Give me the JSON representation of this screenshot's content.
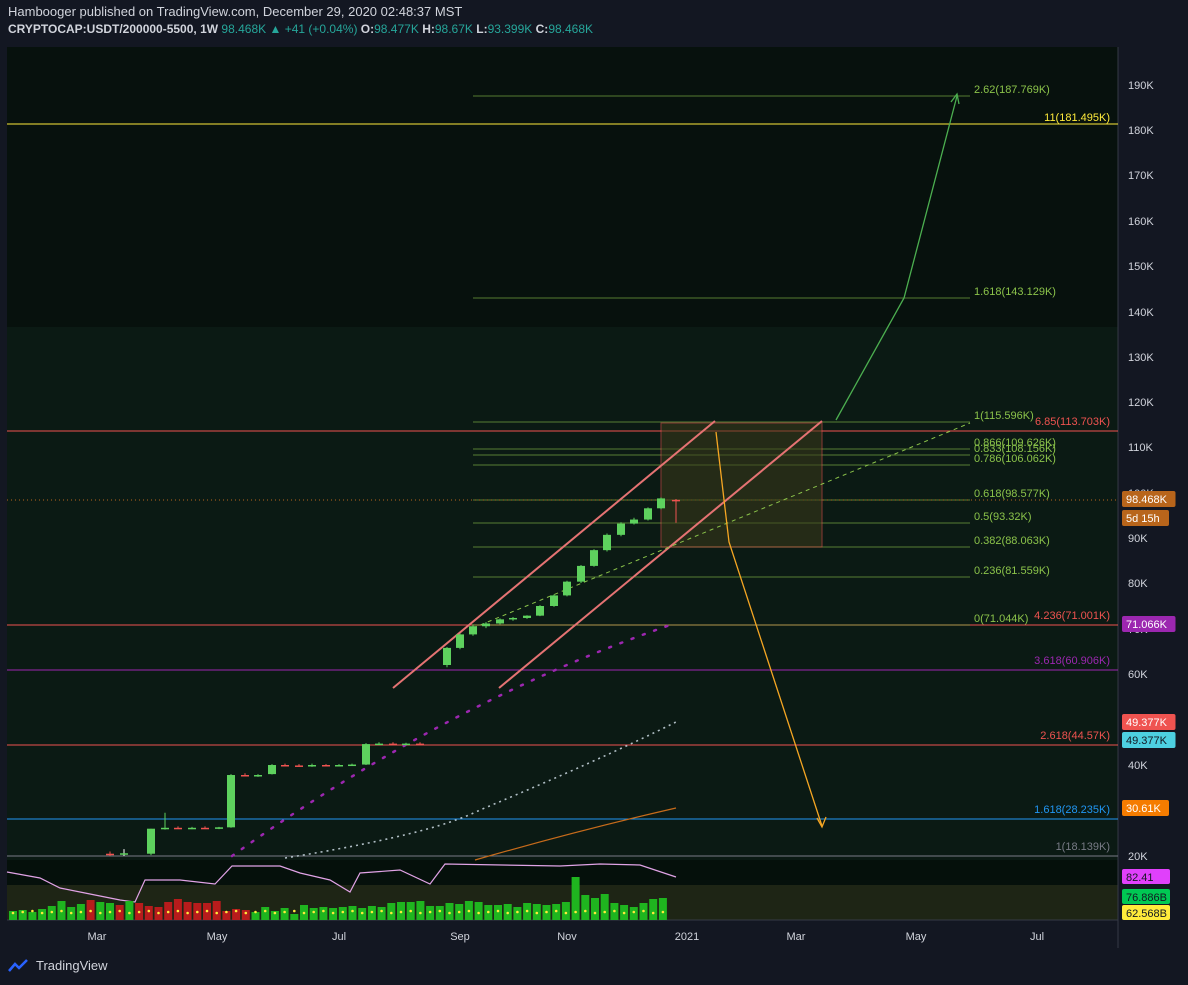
{
  "header": {
    "line1": "Hambooger published on TradingView.com, December 29, 2020 02:48:37 MST",
    "symbol": "CRYPTOCAP:USDT/200000-5500, 1W",
    "last": "98.468K",
    "change": "+41 (+0.04%)",
    "O": "98.477K",
    "H": "98.67K",
    "L": "93.399K",
    "C": "98.468K"
  },
  "footer": {
    "brand": "TradingView"
  },
  "colors": {
    "background": "#131722",
    "panel": "#0b1712",
    "up": "#5ed15e",
    "down": "#ef5350",
    "fib": "#8bc34a",
    "channel": "#e57373",
    "yellow": "#ffeb3b"
  },
  "chart_data": {
    "type": "candlestick",
    "timeframe": "1W",
    "y_axis_ticks": [
      "190K",
      "180K",
      "170K",
      "160K",
      "150K",
      "140K",
      "130K",
      "120K",
      "110K",
      "100K",
      "90K",
      "80K",
      "70K",
      "60K",
      "40K",
      "20K"
    ],
    "y_axis_values": [
      190,
      180,
      170,
      160,
      150,
      140,
      130,
      120,
      110,
      100,
      90,
      80,
      70,
      60,
      40,
      20
    ],
    "x_axis_labels": [
      "Mar",
      "May",
      "Jul",
      "Sep",
      "Nov",
      "2021",
      "Mar",
      "May",
      "Jul"
    ],
    "price_badges": [
      {
        "text": "11(181.495K)",
        "value": 181.495,
        "color": "#ffeb3b"
      },
      {
        "text": "98.468K",
        "value": 98.468,
        "color": "#b8651b"
      },
      {
        "text": "5d 15h",
        "value": 94.5,
        "color": "#b8651b"
      },
      {
        "text": "71.066K",
        "value": 71.066,
        "color": "#9c27b0"
      },
      {
        "text": "49.377K",
        "value": 49.377,
        "color": "#ef5350"
      },
      {
        "text": "49.377K",
        "value": 46.5,
        "color": "#4dd0e1"
      },
      {
        "text": "30.61K",
        "value": 30.61,
        "color": "#f57c00"
      }
    ],
    "fib_levels": [
      {
        "label": "2.62(187.769K)",
        "value": 187.769
      },
      {
        "label": "1.618(143.129K)",
        "value": 143.129
      },
      {
        "label": "1(115.596K)",
        "value": 115.596
      },
      {
        "label": "0.866(109.626K)",
        "value": 109.626
      },
      {
        "label": "0.833(108.156K)",
        "value": 108.156
      },
      {
        "label": "0.786(106.062K)",
        "value": 106.062
      },
      {
        "label": "0.618(98.577K)",
        "value": 98.577
      },
      {
        "label": "0.5(93.32K)",
        "value": 93.32
      },
      {
        "label": "0.382(88.063K)",
        "value": 88.063
      },
      {
        "label": "0.236(81.559K)",
        "value": 81.559
      },
      {
        "label": "0(71.044K)",
        "value": 71.044
      }
    ],
    "horizontal_levels": [
      {
        "label": "6.85(113.703K)",
        "value": 113.703,
        "color": "#ef5350"
      },
      {
        "label": "4.236(71.001K)",
        "value": 71.001,
        "color": "#ef5350"
      },
      {
        "label": "3.618(60.906K)",
        "value": 60.906,
        "color": "#9c27b0"
      },
      {
        "label": "2.618(44.57K)",
        "value": 44.57,
        "color": "#ef5350"
      },
      {
        "label": "1.618(28.235K)",
        "value": 28.235,
        "color": "#2196f3"
      },
      {
        "label": "1(18.139K)",
        "value": 18.139,
        "color": "#787b86"
      }
    ],
    "candles": [
      {
        "o": 20.5,
        "h": 21,
        "l": 20,
        "c": 20.3
      },
      {
        "o": 20.4,
        "h": 21.5,
        "l": 20,
        "c": 20.6
      },
      {
        "o": 20.5,
        "h": 26,
        "l": 20.2,
        "c": 26
      },
      {
        "o": 26,
        "h": 29.5,
        "l": 25.8,
        "c": 26.2
      },
      {
        "o": 26.2,
        "h": 26.5,
        "l": 26,
        "c": 26.1
      },
      {
        "o": 26.1,
        "h": 26.4,
        "l": 25.9,
        "c": 26.2
      },
      {
        "o": 26.2,
        "h": 26.5,
        "l": 26,
        "c": 26.1
      },
      {
        "o": 26.1,
        "h": 26.4,
        "l": 25.9,
        "c": 26.3
      },
      {
        "o": 26.3,
        "h": 38,
        "l": 26.2,
        "c": 37.8
      },
      {
        "o": 37.8,
        "h": 38.2,
        "l": 37.5,
        "c": 37.6
      },
      {
        "o": 37.6,
        "h": 38,
        "l": 37.4,
        "c": 37.8
      },
      {
        "o": 38,
        "h": 40.2,
        "l": 37.9,
        "c": 40
      },
      {
        "o": 40,
        "h": 40.3,
        "l": 39.8,
        "c": 39.9
      },
      {
        "o": 39.9,
        "h": 40.2,
        "l": 39.7,
        "c": 39.8
      },
      {
        "o": 39.8,
        "h": 40.3,
        "l": 39.6,
        "c": 40
      },
      {
        "o": 40,
        "h": 40.2,
        "l": 39.7,
        "c": 39.9
      },
      {
        "o": 39.9,
        "h": 40.2,
        "l": 39.7,
        "c": 40
      },
      {
        "o": 40,
        "h": 40.3,
        "l": 39.8,
        "c": 40.1
      },
      {
        "o": 40.1,
        "h": 44.8,
        "l": 40,
        "c": 44.6
      },
      {
        "o": 44.6,
        "h": 45,
        "l": 44.4,
        "c": 44.7
      },
      {
        "o": 44.7,
        "h": 45,
        "l": 44.4,
        "c": 44.6
      },
      {
        "o": 44.6,
        "h": 44.9,
        "l": 44.3,
        "c": 44.7
      },
      {
        "o": 44.7,
        "h": 45,
        "l": 44.4,
        "c": 44.5
      },
      {
        "o": 62,
        "h": 66,
        "l": 61.5,
        "c": 65.8
      },
      {
        "o": 65.8,
        "h": 69,
        "l": 65.5,
        "c": 68.8
      },
      {
        "o": 68.8,
        "h": 71,
        "l": 68.5,
        "c": 70.6
      },
      {
        "o": 70.6,
        "h": 71.5,
        "l": 70.2,
        "c": 71.2
      },
      {
        "o": 71.2,
        "h": 72.3,
        "l": 71,
        "c": 72.1
      },
      {
        "o": 72.1,
        "h": 72.6,
        "l": 71.8,
        "c": 72.4
      },
      {
        "o": 72.4,
        "h": 73,
        "l": 72.2,
        "c": 72.9
      },
      {
        "o": 72.9,
        "h": 75.2,
        "l": 72.8,
        "c": 75
      },
      {
        "o": 75,
        "h": 77.5,
        "l": 74.8,
        "c": 77.3
      },
      {
        "o": 77.3,
        "h": 80.5,
        "l": 77.1,
        "c": 80.3
      },
      {
        "o": 80.3,
        "h": 84,
        "l": 80,
        "c": 83.8
      },
      {
        "o": 83.8,
        "h": 87.5,
        "l": 83.6,
        "c": 87.3
      },
      {
        "o": 87.3,
        "h": 91,
        "l": 87,
        "c": 90.7
      },
      {
        "o": 90.7,
        "h": 93.5,
        "l": 90.4,
        "c": 93.2
      },
      {
        "o": 93.2,
        "h": 94.5,
        "l": 93,
        "c": 94.1
      },
      {
        "o": 94.1,
        "h": 96.8,
        "l": 93.9,
        "c": 96.6
      },
      {
        "o": 96.6,
        "h": 99,
        "l": 96.4,
        "c": 98.8
      },
      {
        "o": 98.477,
        "h": 98.67,
        "l": 93.399,
        "c": 98.468
      }
    ],
    "volume_badges": [
      {
        "text": "82.41",
        "color": "#e040fb"
      },
      {
        "text": "76.886B",
        "color": "#00c853"
      },
      {
        "text": "62.568B",
        "color": "#ffeb3b"
      }
    ]
  }
}
